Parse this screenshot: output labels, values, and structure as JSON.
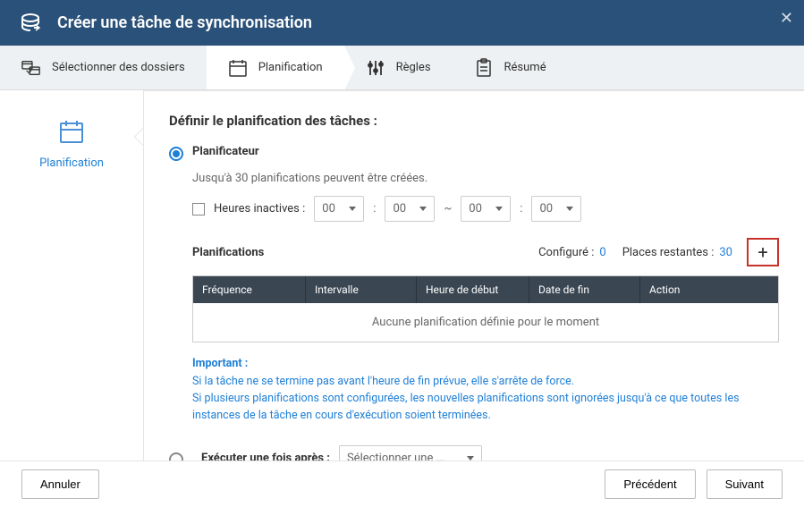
{
  "title": "Créer une tâche de synchronisation",
  "steps": {
    "folders": "Sélectionner des dossiers",
    "schedule": "Planification",
    "rules": "Règles",
    "summary": "Résumé"
  },
  "sidebar": {
    "label": "Planification"
  },
  "section_title": "Définir le planification des tâches :",
  "scheduler": {
    "label": "Planificateur",
    "desc": "Jusqu'à 30 planifications peuvent être créées.",
    "inactive_hours_label": "Heures inactives :",
    "hours": [
      "00",
      "00",
      "00",
      "00"
    ],
    "colon": ":",
    "tilde": "~",
    "planning_label": "Planifications",
    "configured_label": "Configuré :",
    "configured_value": "0",
    "remaining_label": "Places restantes :",
    "remaining_value": "30",
    "columns": {
      "c1": "Fréquence",
      "c2": "Intervalle",
      "c3": "Heure de début",
      "c4": "Date de fin",
      "c5": "Action"
    },
    "empty": "Aucune planification définie pour le moment",
    "important_title": "Important :",
    "important_line1": "Si la tâche ne se termine pas avant l'heure de fin prévue, elle s'arrête de force.",
    "important_line2": "Si plusieurs planifications sont configurées, les nouvelles planifications sont ignorées jusqu'à ce que toutes les instances de la tâche en cours d'exécution soient terminées."
  },
  "run_once": {
    "label": "Exécuter une fois après :",
    "select": "Sélectionner une …"
  },
  "footer": {
    "cancel": "Annuler",
    "prev": "Précédent",
    "next": "Suivant"
  }
}
